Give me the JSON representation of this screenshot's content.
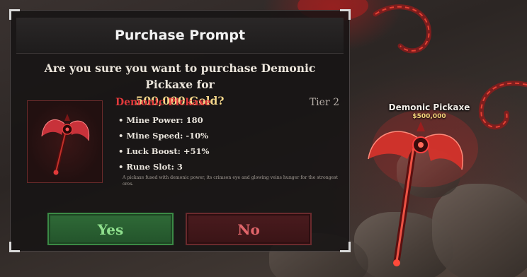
{
  "dialog": {
    "title": "Purchase Prompt",
    "question_prefix": "Are you sure you want to purchase Demonic Pickaxe for",
    "question_price": "500,000 Gold?",
    "item": {
      "name": "Demonic Pickaxe",
      "tier": "Tier 2",
      "stats": [
        "Mine Power: 180",
        "Mine Speed: -10%",
        "Luck Boost: +51%",
        "Rune Slot: 3"
      ],
      "description": "A pickaxe fused with demonic power, its crimson eye and glowing veins hunger for the strongest ores."
    },
    "buttons": {
      "yes": "Yes",
      "no": "No"
    }
  },
  "world_item": {
    "name": "Demonic Pickaxe",
    "price": "$500,000"
  },
  "colors": {
    "item_name": "#e0393b",
    "gold_text": "#f2d68a",
    "yes_button": "#2f6a37",
    "no_button": "#4a1b1e",
    "world_glow": "#ff3a3a"
  },
  "icons": [
    "demonic-pickaxe-icon",
    "world-pickaxe-model"
  ]
}
